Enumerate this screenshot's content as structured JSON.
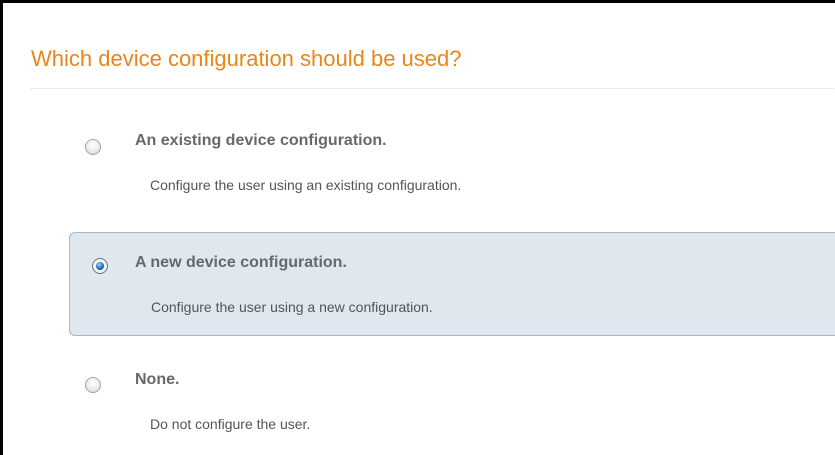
{
  "colors": {
    "title": "#e8861a",
    "label": "#686868",
    "description": "#555555",
    "selected_background": "#dfe7ef",
    "selected_border": "#a9b6c6",
    "radio_dot": "#1c6fb8"
  },
  "question": {
    "title": "Which device configuration should be used?"
  },
  "options": [
    {
      "label": "An existing device configuration.",
      "description": "Configure the user using an existing configuration.",
      "selected": false
    },
    {
      "label": "A new device configuration.",
      "description": "Configure the user using a new configuration.",
      "selected": true
    },
    {
      "label": "None.",
      "description": "Do not configure the user.",
      "selected": false
    }
  ]
}
